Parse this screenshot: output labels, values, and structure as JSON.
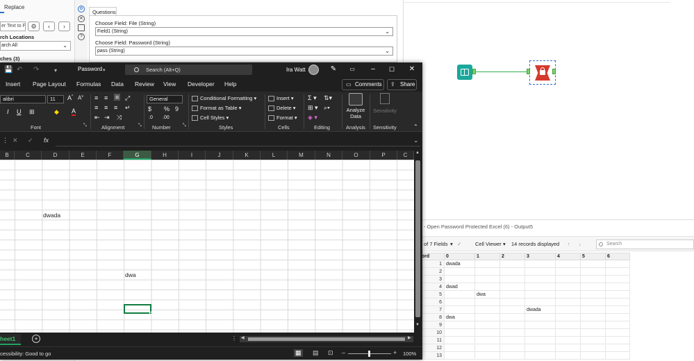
{
  "alteryx": {
    "left_panel": {
      "tab_replace": "Replace",
      "find_input_value": "er Text to F",
      "search_locations_label": "rch Locations",
      "search_select_value": "arch All",
      "matches_label": "ches (3)"
    },
    "config": {
      "tab_label": "Questions",
      "field1_label": "Choose Field: File (String)",
      "field1_value": "Field1 (String)",
      "field2_label": "Choose Field: Password (String)",
      "field2_value": "pass (String)"
    },
    "results": {
      "title": "s - Open Password Protected Excel (6) - Output5",
      "fields_label": "of 7 Fields",
      "viewer_label": "Cell Viewer",
      "records_label": "14 records displayed",
      "search_placeholder": "Search",
      "columns": [
        "cord",
        "0",
        "1",
        "2",
        "3",
        "4",
        "5",
        "6"
      ],
      "rows": [
        [
          "1",
          "dwada",
          "",
          "",
          "",
          "",
          "",
          ""
        ],
        [
          "2",
          "",
          "",
          "",
          "",
          "",
          "",
          ""
        ],
        [
          "3",
          "",
          "",
          "",
          "",
          "",
          "",
          ""
        ],
        [
          "4",
          "dwad",
          "",
          "",
          "",
          "",
          "",
          ""
        ],
        [
          "5",
          "",
          "dwa",
          "",
          "",
          "",
          "",
          ""
        ],
        [
          "6",
          "",
          "",
          "",
          "",
          "",
          "",
          ""
        ],
        [
          "7",
          "",
          "",
          "",
          "dwada",
          "",
          "",
          ""
        ],
        [
          "8",
          "dwa",
          "",
          "",
          "",
          "",
          "",
          ""
        ],
        [
          "9",
          "",
          "",
          "",
          "",
          "",
          "",
          ""
        ],
        [
          "10",
          "",
          "",
          "",
          "",
          "",
          "",
          ""
        ],
        [
          "11",
          "",
          "",
          "",
          "",
          "",
          "",
          ""
        ],
        [
          "12",
          "",
          "",
          "",
          "",
          "",
          "",
          ""
        ],
        [
          "13",
          "",
          "",
          "",
          "",
          "",
          "",
          ""
        ]
      ]
    }
  },
  "excel": {
    "workbook_name": "Password",
    "search_placeholder": "Search (Alt+Q)",
    "user_name": "Ira Watt",
    "menu": [
      "Insert",
      "Page Layout",
      "Formulas",
      "Data",
      "Review",
      "View",
      "Developer",
      "Help"
    ],
    "comments_label": "Comments",
    "share_label": "Share",
    "ribbon": {
      "font_name": "alibri",
      "font_size": "11",
      "number_format": "General",
      "conditional_formatting": "Conditional Formatting",
      "format_as_table": "Format as Table",
      "cell_styles": "Cell Styles",
      "insert": "Insert",
      "delete": "Delete",
      "format": "Format",
      "analyze_data_1": "Analyze",
      "analyze_data_2": "Data",
      "sensitivity": "Sensitivity",
      "groups": [
        "Font",
        "Alignment",
        "Number",
        "Styles",
        "Cells",
        "Editing",
        "Analysis",
        "Sensitivity"
      ]
    },
    "columns": [
      "B",
      "C",
      "D",
      "E",
      "F",
      "G",
      "H",
      "I",
      "J",
      "K",
      "L",
      "M",
      "N",
      "O",
      "P",
      "C"
    ],
    "cells": [
      {
        "text": "dwada"
      },
      {
        "text": "dwa"
      }
    ],
    "sheet_tab": "heet1",
    "status": {
      "accessibility": "cessibility: Good to go",
      "zoom": "100%"
    }
  }
}
